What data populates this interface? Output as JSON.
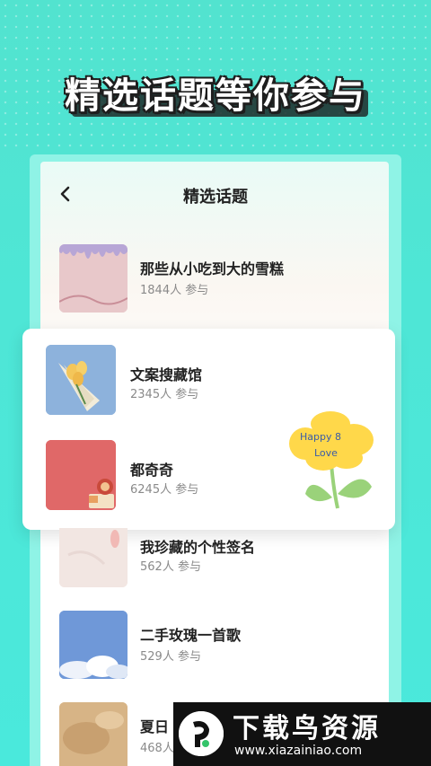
{
  "promo": {
    "headline": "精选话题等你参与"
  },
  "header": {
    "title": "精选话题",
    "back_icon": "chevron-left-icon"
  },
  "topics": [
    {
      "title": "那些从小吃到大的雪糕",
      "meta": "1844人 参与"
    },
    {
      "title": "文案搜藏馆",
      "meta": "2345人 参与"
    },
    {
      "title": "都奇奇",
      "meta": "6245人 参与"
    },
    {
      "title": "我珍藏的个性签名",
      "meta": "562人 参与"
    },
    {
      "title": "二手玫瑰一首歌",
      "meta": "529人 参与"
    },
    {
      "title": "夏日",
      "meta": "468人"
    }
  ],
  "sticker": {
    "text_line1": "Happy 8",
    "text_line2": "Love"
  },
  "watermark": {
    "title": "下载鸟资源",
    "url": "www.xiazainiao.com"
  },
  "colors": {
    "background": "#4ee6d6",
    "card": "#ffffff",
    "title_text": "#222222",
    "meta_text": "#8a8a8a"
  }
}
